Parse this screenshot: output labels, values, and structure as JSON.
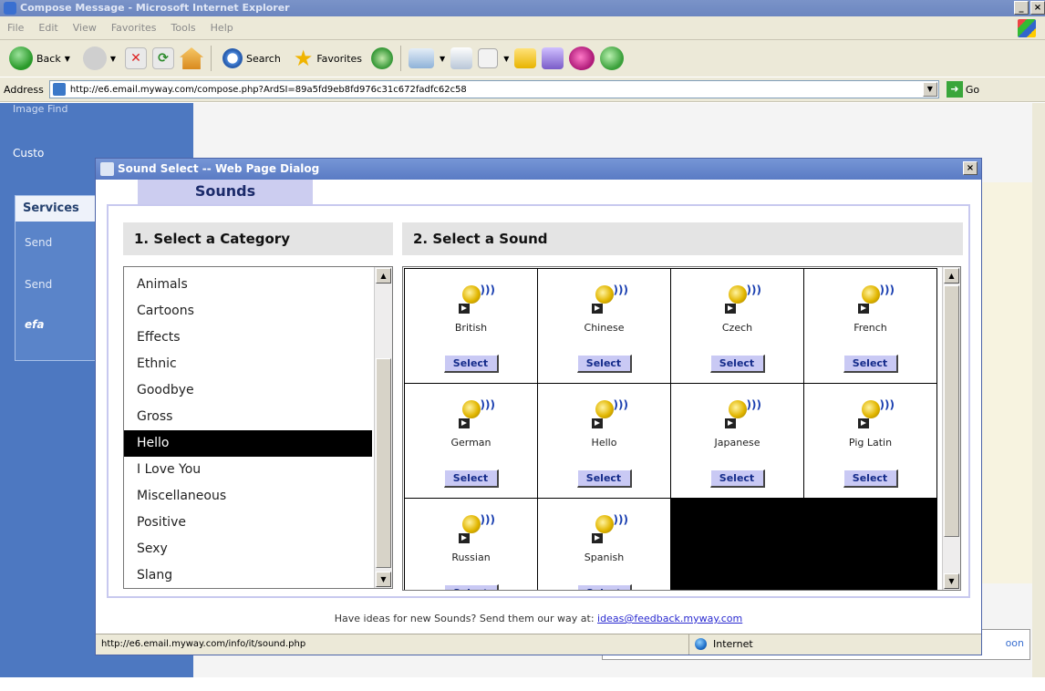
{
  "ie": {
    "title": "Compose Message - Microsoft Internet Explorer",
    "menu": [
      "File",
      "Edit",
      "View",
      "Favorites",
      "Tools",
      "Help"
    ],
    "toolbar": {
      "back": "Back",
      "search": "Search",
      "favorites": "Favorites"
    },
    "address_label": "Address",
    "address_url": "http://e6.email.myway.com/compose.php?ArdSI=89a5fd9eb8fd976c31c672fadfc62c58",
    "go": "Go",
    "window_buttons": [
      "_",
      "×"
    ]
  },
  "page": {
    "sidebar": {
      "item_top": "Image Find",
      "item_custom": "Custo"
    },
    "services": {
      "header": "Services",
      "items": [
        "Send",
        "Send",
        "efa"
      ]
    },
    "right_tab": "oon"
  },
  "dialog": {
    "title": "Sound Select -- Web Page Dialog",
    "close": "×",
    "tab": "Sounds",
    "category_header": "1. Select a Category",
    "sound_header": "2. Select a Sound",
    "categories": [
      "Animals",
      "Cartoons",
      "Effects",
      "Ethnic",
      "Goodbye",
      "Gross",
      "Hello",
      "I Love You",
      "Miscellaneous",
      "Positive",
      "Sexy",
      "Slang"
    ],
    "selected_category": "Hello",
    "sounds": [
      {
        "name": "British",
        "button": "Select"
      },
      {
        "name": "Chinese",
        "button": "Select"
      },
      {
        "name": "Czech",
        "button": "Select"
      },
      {
        "name": "French",
        "button": "Select"
      },
      {
        "name": "German",
        "button": "Select"
      },
      {
        "name": "Hello",
        "button": "Select"
      },
      {
        "name": "Japanese",
        "button": "Select"
      },
      {
        "name": "Pig Latin",
        "button": "Select"
      },
      {
        "name": "Russian",
        "button": "Select"
      },
      {
        "name": "Spanish",
        "button": "Select"
      }
    ],
    "ideas_text": "Have ideas for new Sounds? Send them our way at:",
    "ideas_email": "ideas@feedback.myway.com",
    "status_url": "http://e6.email.myway.com/info/it/sound.php",
    "status_zone": "Internet"
  },
  "colors": {
    "selected_bg": "#000000",
    "tab_bg": "#cccdf0",
    "select_btn": "#c9c9f4",
    "sidebar": "#4d78c1"
  }
}
